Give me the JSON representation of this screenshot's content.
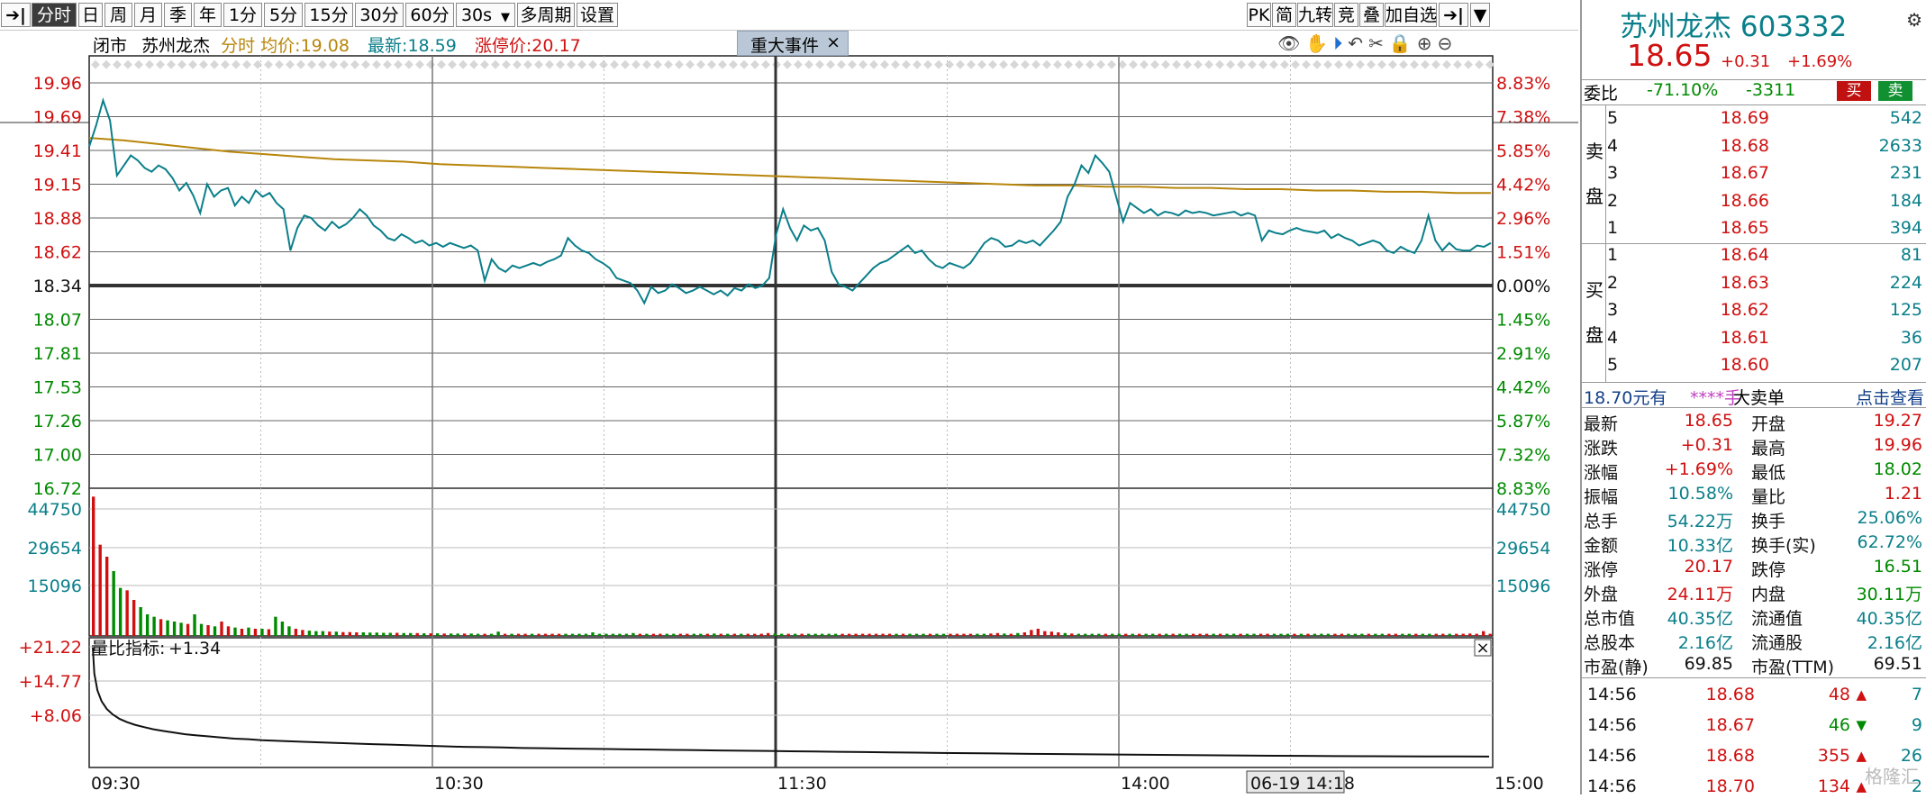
{
  "toolbar": {
    "left": [
      {
        "label": "分时",
        "active": true
      },
      {
        "label": "日"
      },
      {
        "label": "周"
      },
      {
        "label": "月"
      },
      {
        "label": "季"
      },
      {
        "label": "年"
      },
      {
        "label": "1分"
      },
      {
        "label": "5分"
      },
      {
        "label": "15分"
      },
      {
        "label": "30分"
      },
      {
        "label": "60分"
      },
      {
        "label": "30s"
      },
      {
        "label": "多周期"
      },
      {
        "label": "设置"
      }
    ],
    "right": [
      {
        "label": "PK"
      },
      {
        "label": "简"
      },
      {
        "label": "九转"
      },
      {
        "label": "竞"
      },
      {
        "label": "叠"
      },
      {
        "label": "加自选"
      }
    ],
    "dropdown_caret": "▼"
  },
  "chart_header": {
    "status": "闭市",
    "stock": "苏州龙杰",
    "avg_label": "分时 均价:",
    "avg_value": "19.08",
    "latest_label": "最新:",
    "latest_value": "18.59",
    "limit_label": "涨停价:",
    "limit_value": "20.17",
    "event_button": "重大事件",
    "event_close": "×"
  },
  "chart_data": [
    {
      "type": "line",
      "name": "price-panel",
      "x_labels": [
        "09:30",
        "10:30",
        "11:30",
        "14:00",
        "15:00"
      ],
      "cursor_label": "06-19 14:18",
      "y_ticks_left": [
        "19.96",
        "19.69",
        "19.41",
        "19.15",
        "18.88",
        "18.62",
        "18.34",
        "18.07",
        "17.81",
        "17.53",
        "17.26",
        "17.00",
        "16.72"
      ],
      "y_ticks_right": [
        "8.83%",
        "7.38%",
        "5.85%",
        "4.42%",
        "2.96%",
        "1.51%",
        "0.00%",
        "1.45%",
        "2.91%",
        "4.42%",
        "5.87%",
        "7.32%",
        "8.83%"
      ],
      "ylim": [
        16.72,
        19.96
      ],
      "prev_close": 18.34,
      "series": [
        {
          "values": [
            19.45,
            19.62,
            19.82,
            19.66,
            19.22,
            19.3,
            19.38,
            19.34,
            19.28,
            19.25,
            19.3,
            19.27,
            19.2,
            19.1,
            19.16,
            19.06,
            18.92,
            19.15,
            19.05,
            19.1,
            19.12,
            18.98,
            19.05,
            19.0,
            19.1,
            19.05,
            19.08,
            19.0,
            18.95,
            18.62,
            18.8,
            18.9,
            18.88,
            18.82,
            18.78,
            18.85,
            18.8,
            18.83,
            18.88,
            18.95,
            18.9,
            18.82,
            18.78,
            18.72,
            18.7,
            18.75,
            18.72,
            18.68,
            18.7,
            18.66,
            18.68,
            18.65,
            18.68,
            18.66,
            18.64,
            18.66,
            18.62,
            18.38,
            18.55,
            18.48,
            18.45,
            18.5,
            18.48,
            18.5,
            18.52,
            18.5,
            18.53,
            18.55,
            18.58,
            18.72,
            18.66,
            18.62,
            18.6,
            18.55,
            18.52,
            18.48,
            18.4,
            18.38,
            18.36,
            18.3,
            18.2,
            18.33,
            18.28,
            18.3,
            18.35,
            18.32,
            18.28,
            18.3,
            18.33,
            18.3,
            18.27,
            18.3,
            18.26,
            18.32,
            18.3,
            18.35,
            18.32,
            18.34,
            18.4,
            18.75,
            18.95,
            18.8,
            18.7,
            18.82,
            18.78,
            18.8,
            18.7,
            18.45,
            18.35,
            18.33,
            18.3,
            18.36,
            18.42,
            18.48,
            18.52,
            18.54,
            18.58,
            18.62,
            18.66,
            18.6,
            18.62,
            18.55,
            18.5,
            18.48,
            18.52,
            18.5,
            18.48,
            18.52,
            18.6,
            18.68,
            18.72,
            18.7,
            18.65,
            18.66,
            18.7,
            18.68,
            18.7,
            18.66,
            18.72,
            18.78,
            18.85,
            19.05,
            19.15,
            19.3,
            19.24,
            19.38,
            19.32,
            19.25,
            19.05,
            18.85,
            19.0,
            18.96,
            18.92,
            18.95,
            18.9,
            18.93,
            18.92,
            18.9,
            18.94,
            18.92,
            18.93,
            18.92,
            18.9,
            18.91,
            18.92,
            18.93,
            18.9,
            18.92,
            18.9,
            18.7,
            18.78,
            18.76,
            18.75,
            18.78,
            18.8,
            18.78,
            18.77,
            18.76,
            18.78,
            18.72,
            18.75,
            18.72,
            18.7,
            18.66,
            18.68,
            18.7,
            18.68,
            18.62,
            18.6,
            18.65,
            18.62,
            18.6,
            18.7,
            18.9,
            18.7,
            18.62,
            18.68,
            18.63,
            18.62,
            18.62,
            18.66,
            18.65,
            18.68
          ]
        },
        {
          "values": [
            19.52,
            19.5,
            19.47,
            19.44,
            19.41,
            19.39,
            19.37,
            19.35,
            19.34,
            19.33,
            19.31,
            19.3,
            19.29,
            19.28,
            19.27,
            19.26,
            19.25,
            19.24,
            19.23,
            19.22,
            19.21,
            19.2,
            19.19,
            19.18,
            19.17,
            19.16,
            19.15,
            19.14,
            19.14,
            19.13,
            19.13,
            19.12,
            19.12,
            19.11,
            19.11,
            19.1,
            19.1,
            19.09,
            19.09,
            19.08,
            19.08
          ]
        }
      ]
    },
    {
      "type": "bar",
      "name": "volume-panel",
      "y_ticks_left": [
        "44750",
        "29654",
        "15096"
      ],
      "y_ticks_right": [
        "44750",
        "29654",
        "15096"
      ],
      "ylim": [
        0,
        60000
      ],
      "series": [
        {
          "values": [
            58000,
            38000,
            33000,
            27000,
            20000,
            19000,
            15000,
            12000,
            9000,
            8000,
            7000,
            6500,
            6000,
            5500,
            5000,
            9000,
            5000,
            4500,
            4000,
            6000,
            4000,
            3500,
            3000,
            3500,
            3000,
            3000,
            2800,
            8000,
            6000,
            4000,
            3000,
            2500,
            2200,
            2000,
            2000,
            1800,
            1800,
            1600,
            1600,
            1500,
            1500,
            1400,
            1400,
            1300,
            1300,
            1300,
            1200,
            1200,
            1200,
            1100,
            1100,
            1100,
            1000,
            1000,
            1000,
            1000,
            1000,
            900,
            900,
            900,
            1800,
            900,
            900,
            900,
            900,
            900,
            900,
            900,
            900,
            900,
            900,
            900,
            900,
            900,
            1500,
            900,
            900,
            900,
            900,
            900,
            1200,
            900,
            900,
            900,
            900,
            900,
            900,
            900,
            900,
            900,
            900,
            900,
            1000,
            900,
            900,
            900,
            900,
            900,
            900,
            900,
            1200,
            1000,
            900,
            900,
            900,
            900,
            900,
            900,
            900,
            900,
            900,
            900,
            900,
            900,
            900,
            900,
            900,
            900,
            900,
            900,
            900,
            900,
            900,
            900,
            900,
            900,
            900,
            900,
            900,
            900,
            900,
            900,
            900,
            1000,
            1200,
            1000,
            900,
            1200,
            1500,
            2500,
            3000,
            2000,
            1800,
            1500,
            1200,
            1000,
            900,
            900,
            900,
            900,
            900,
            900,
            900,
            900,
            900,
            900,
            900,
            900,
            900,
            900,
            900,
            900,
            900,
            900,
            900,
            900,
            900,
            900,
            900,
            900,
            900,
            900,
            900,
            900,
            900,
            900,
            900,
            900,
            900,
            900,
            900,
            900,
            900,
            900,
            900,
            900,
            900,
            900,
            900,
            900,
            900,
            900,
            900,
            900,
            900,
            900,
            900,
            900,
            900,
            900,
            900,
            900,
            900,
            900,
            1000,
            900,
            2000,
            900
          ]
        }
      ]
    },
    {
      "type": "line",
      "name": "volume-ratio-panel",
      "title": "量比指标:",
      "current": "+1.34",
      "y_ticks_left": [
        "+21.22",
        "+14.77",
        "+8.06"
      ],
      "ylim": [
        0,
        22
      ],
      "series": [
        {
          "values": [
            21.22,
            16.5,
            13.4,
            11.4,
            10.0,
            9.0,
            8.2,
            7.6,
            7.1,
            6.7,
            6.3,
            6.0,
            5.7,
            5.4,
            5.2,
            5.0,
            4.8,
            4.6,
            4.5,
            4.3,
            4.2,
            4.1,
            4.0,
            3.9,
            3.8,
            3.7,
            3.6,
            3.5,
            3.4,
            3.3,
            3.2,
            3.1,
            3.05,
            3.0,
            2.9,
            2.85,
            2.8,
            2.75,
            2.7,
            2.65,
            2.6,
            2.55,
            2.5,
            2.45,
            2.4,
            2.35,
            2.3,
            2.25,
            2.2,
            2.15,
            2.1,
            2.05,
            2.0,
            1.95,
            1.9,
            1.85,
            1.8,
            1.76,
            1.72,
            1.68,
            1.64,
            1.6,
            1.56,
            1.52,
            1.48,
            1.45,
            1.42,
            1.4,
            1.38,
            1.36,
            1.35,
            1.34
          ]
        }
      ]
    }
  ],
  "quote": {
    "name": "苏州龙杰",
    "code": "603332",
    "price": "18.65",
    "change": "+0.31",
    "change_pct": "+1.69%",
    "weibi_label": "委比",
    "weibi_pct": "-71.10%",
    "weibi_diff": "-3311",
    "buy_btn": "买",
    "sell_btn": "卖",
    "sell_side_label": [
      "卖",
      "盘"
    ],
    "buy_side_label": [
      "买",
      "盘"
    ],
    "asks": [
      {
        "lvl": "5",
        "price": "18.69",
        "vol": "542"
      },
      {
        "lvl": "4",
        "price": "18.68",
        "vol": "2633"
      },
      {
        "lvl": "3",
        "price": "18.67",
        "vol": "231"
      },
      {
        "lvl": "2",
        "price": "18.66",
        "vol": "184"
      },
      {
        "lvl": "1",
        "price": "18.65",
        "vol": "394"
      }
    ],
    "bids": [
      {
        "lvl": "1",
        "price": "18.64",
        "vol": "81"
      },
      {
        "lvl": "2",
        "price": "18.63",
        "vol": "224"
      },
      {
        "lvl": "3",
        "price": "18.62",
        "vol": "125"
      },
      {
        "lvl": "4",
        "price": "18.61",
        "vol": "36"
      },
      {
        "lvl": "5",
        "price": "18.60",
        "vol": "207"
      }
    ],
    "big_order": {
      "price": "18.70元有",
      "qty": "****手",
      "label": "大卖单",
      "link": "点击查看"
    },
    "stats": [
      {
        "l1": "最新",
        "v1": "18.65",
        "c1": "red",
        "l2": "开盘",
        "v2": "19.27",
        "c2": "red"
      },
      {
        "l1": "涨跌",
        "v1": "+0.31",
        "c1": "red",
        "l2": "最高",
        "v2": "19.96",
        "c2": "red"
      },
      {
        "l1": "涨幅",
        "v1": "+1.69%",
        "c1": "red",
        "l2": "最低",
        "v2": "18.02",
        "c2": "green"
      },
      {
        "l1": "振幅",
        "v1": "10.58%",
        "c1": "teal",
        "l2": "量比",
        "v2": "1.21",
        "c2": "red"
      },
      {
        "l1": "总手",
        "v1": "54.22万",
        "c1": "teal",
        "l2": "换手",
        "v2": "25.06%",
        "c2": "teal"
      },
      {
        "l1": "金额",
        "v1": "10.33亿",
        "c1": "teal",
        "l2": "换手(实)",
        "v2": "62.72%",
        "c2": "teal"
      },
      {
        "l1": "涨停",
        "v1": "20.17",
        "c1": "red",
        "l2": "跌停",
        "v2": "16.51",
        "c2": "green"
      },
      {
        "l1": "外盘",
        "v1": "24.11万",
        "c1": "red",
        "l2": "内盘",
        "v2": "30.11万",
        "c2": "green"
      },
      {
        "l1": "总市值",
        "v1": "40.35亿",
        "c1": "teal",
        "l2": "流通值",
        "v2": "40.35亿",
        "c2": "teal"
      },
      {
        "l1": "总股本",
        "v1": "2.16亿",
        "c1": "teal",
        "l2": "流通股",
        "v2": "2.16亿",
        "c2": "teal"
      },
      {
        "l1": "市盈(静)",
        "v1": "69.85",
        "c1": "dark",
        "l2": "市盈(TTM)",
        "v2": "69.51",
        "c2": "dark"
      }
    ],
    "ticks": [
      {
        "time": "14:56",
        "price": "18.68",
        "vol": "48",
        "dir": "up",
        "n": "7"
      },
      {
        "time": "14:56",
        "price": "18.67",
        "vol": "46",
        "dir": "down",
        "n": "9"
      },
      {
        "time": "14:56",
        "price": "18.68",
        "vol": "355",
        "dir": "up",
        "n": "26"
      },
      {
        "time": "14:56",
        "price": "18.70",
        "vol": "134",
        "dir": "up",
        "n": "2"
      }
    ],
    "watermark": "格隆汇"
  },
  "colors": {
    "price": "#0a7f8a",
    "avg": "#b8860b",
    "up": "#d01010",
    "down": "#008a00",
    "vol_up": "#d01010",
    "vol_down": "#008a00"
  }
}
